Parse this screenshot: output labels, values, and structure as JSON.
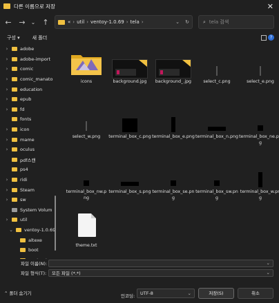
{
  "window": {
    "title": "다른 이름으로 저장",
    "close_glyph": "✕"
  },
  "nav": {
    "back": "←",
    "forward": "→",
    "recent": "⌄",
    "up": "↑"
  },
  "address": {
    "root": "«",
    "crumbs": [
      "util",
      "ventoy-1.0.69",
      "tela"
    ],
    "separator": "›",
    "dropdown": "⌄",
    "refresh": "↻"
  },
  "search": {
    "placeholder": "tela 검색",
    "icon": "⌕"
  },
  "toolbar": {
    "organize": "구성 ▾",
    "new_folder": "새 폴더",
    "help": "?"
  },
  "sidebar": {
    "items": [
      {
        "label": "adobe",
        "chev": "›",
        "indent": 1
      },
      {
        "label": "adobe-import",
        "chev": "›",
        "indent": 1
      },
      {
        "label": "comic",
        "chev": "›",
        "indent": 1
      },
      {
        "label": "comic_manato",
        "chev": "›",
        "indent": 1
      },
      {
        "label": "education",
        "chev": "›",
        "indent": 1
      },
      {
        "label": "epub",
        "chev": "›",
        "indent": 1
      },
      {
        "label": "fd",
        "chev": "›",
        "indent": 1
      },
      {
        "label": "fonts",
        "chev": "",
        "indent": 1
      },
      {
        "label": "icon",
        "chev": "›",
        "indent": 1
      },
      {
        "label": "mame",
        "chev": "›",
        "indent": 1
      },
      {
        "label": "oculus",
        "chev": "›",
        "indent": 1
      },
      {
        "label": "pdf스캔",
        "chev": "",
        "indent": 1
      },
      {
        "label": "ps4",
        "chev": "",
        "indent": 1
      },
      {
        "label": "ridi",
        "chev": "›",
        "indent": 1
      },
      {
        "label": "Steam",
        "chev": "›",
        "indent": 1
      },
      {
        "label": "sw",
        "chev": "›",
        "indent": 1
      },
      {
        "label": "System Volum",
        "chev": "",
        "indent": 1
      },
      {
        "label": "util",
        "chev": "›",
        "indent": 1
      },
      {
        "label": "ventoy-1.0.69",
        "chev": "⌄",
        "indent": 2
      },
      {
        "label": "altexe",
        "chev": "",
        "indent": 3
      },
      {
        "label": "boot",
        "chev": "",
        "indent": 3
      },
      {
        "label": "pentract-gr",
        "chev": "›",
        "indent": 3
      }
    ]
  },
  "files": [
    {
      "name": "icons",
      "kind": "folder"
    },
    {
      "name": "background.jpg",
      "kind": "bg"
    },
    {
      "name": "background_.jpg",
      "kind": "bg"
    },
    {
      "name": "select_c.png",
      "kind": "vline"
    },
    {
      "name": "select_e.png",
      "kind": "vline"
    },
    {
      "name": "select_w.png",
      "kind": "vline"
    },
    {
      "name": "terminal_box_c.png",
      "kind": "block"
    },
    {
      "name": "terminal_box_e.png",
      "kind": "vblock"
    },
    {
      "name": "terminal_box_n.png",
      "kind": "hline"
    },
    {
      "name": "terminal_box_ne.png",
      "kind": "corner"
    },
    {
      "name": "terminal_box_nw.png",
      "kind": "corner"
    },
    {
      "name": "terminal_box_s.png",
      "kind": "hline"
    },
    {
      "name": "terminal_box_se.png",
      "kind": "corner"
    },
    {
      "name": "terminal_box_sw.png",
      "kind": "corner"
    },
    {
      "name": "terminal_box_w.png",
      "kind": "vblock"
    },
    {
      "name": "theme.txt",
      "kind": "doc"
    }
  ],
  "footer": {
    "filename_label": "파일 이름(N):",
    "filename_value": "",
    "filetype_label": "파일 형식(T):",
    "filetype_value": "모든 파일  (*.*)",
    "dropdown": "⌄",
    "hide_folders": "⌃ 폴더 숨기기",
    "encoding_label": "인코딩:",
    "encoding_value": "UTF-8",
    "save": "저장(S)",
    "cancel": "취소"
  },
  "colors": {
    "folder": "#f0c040",
    "accent": "#2f6fd6",
    "bg": "#202020"
  }
}
